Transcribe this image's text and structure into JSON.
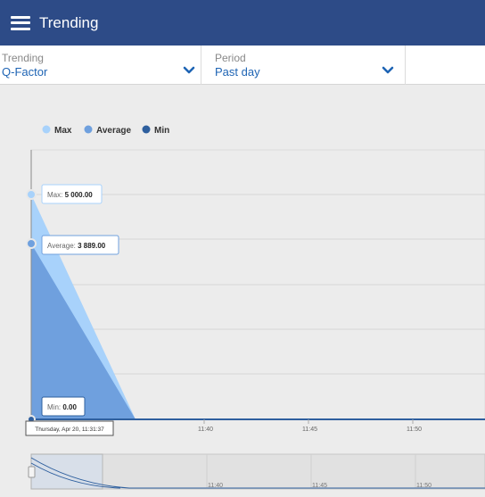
{
  "header": {
    "title": "Trending"
  },
  "filters": {
    "trending": {
      "label": "Trending",
      "value": "Q-Factor"
    },
    "period": {
      "label": "Period",
      "value": "Past day"
    }
  },
  "colors": {
    "header": "#2d4b87",
    "accent": "#1e64b4",
    "max": "#a8d2fb",
    "average": "#6fa0de",
    "min": "#2e5f9e"
  },
  "icons": {
    "menu": "hamburger-icon",
    "dropdown": "chevron-down-icon"
  },
  "chart_data": {
    "type": "area",
    "title": "",
    "legend": [
      "Max",
      "Average",
      "Min"
    ],
    "legend_position": "top-left",
    "x_ticks": [
      "11:40",
      "11:45",
      "11:50"
    ],
    "ylim": [
      0,
      5000
    ],
    "grid": true,
    "series": [
      {
        "name": "Max",
        "x": [
          "11:31:37",
          "11:35:32"
        ],
        "values": [
          5000.0,
          0
        ]
      },
      {
        "name": "Average",
        "x": [
          "11:31:37",
          "11:35:32"
        ],
        "values": [
          3889.0,
          0
        ]
      },
      {
        "name": "Min",
        "x": [
          "11:31:37",
          "11:35:32"
        ],
        "values": [
          0.0,
          0
        ]
      }
    ],
    "tooltips": [
      {
        "label": "Max",
        "value": "5 000.00"
      },
      {
        "label": "Average",
        "value": "3 889.00"
      },
      {
        "label": "Min",
        "value": "0.00"
      }
    ],
    "crosshair_label": "Thursday, Apr 20, 11:31:37",
    "navigator_ticks": [
      "11:40",
      "11:45",
      "11:50"
    ]
  }
}
